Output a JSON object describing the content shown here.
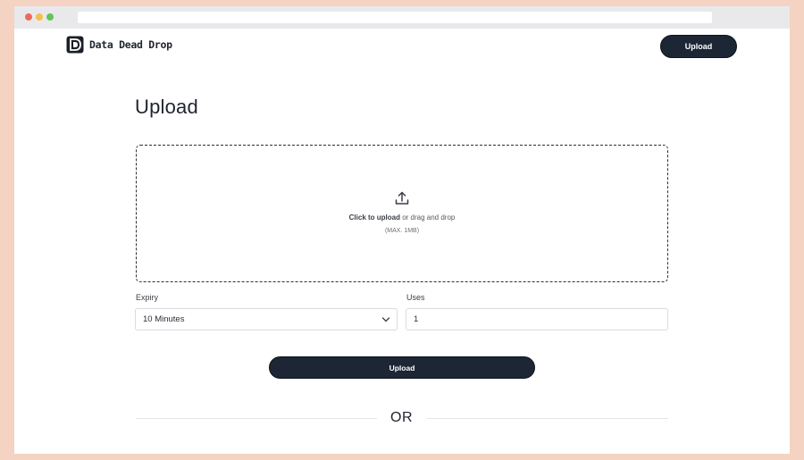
{
  "browser": {
    "window_controls": [
      "close",
      "minimize",
      "maximize"
    ],
    "control_colors": {
      "close": "#ef6a5e",
      "minimize": "#f5be4f",
      "maximize": "#62c554"
    }
  },
  "header": {
    "logo_icon": "dead-drop-d-logo-icon",
    "brand_name": "Data Dead Drop",
    "upload_button_label": "Upload"
  },
  "main": {
    "title": "Upload",
    "dropzone": {
      "icon": "upload-arrow-icon",
      "click_text": "Click to upload",
      "drag_text": " or drag and drop",
      "limit_text": "(MAX. 1MB)"
    },
    "expiry": {
      "label": "Expiry",
      "selected": "10 Minutes",
      "icon": "chevron-down-icon"
    },
    "uses": {
      "label": "Uses",
      "value": "1"
    },
    "upload_button_label": "Upload",
    "divider_text": "OR"
  },
  "colors": {
    "page_background": "#f4d3c2",
    "button_dark": "#1d2634",
    "text_primary": "#1f2430"
  }
}
